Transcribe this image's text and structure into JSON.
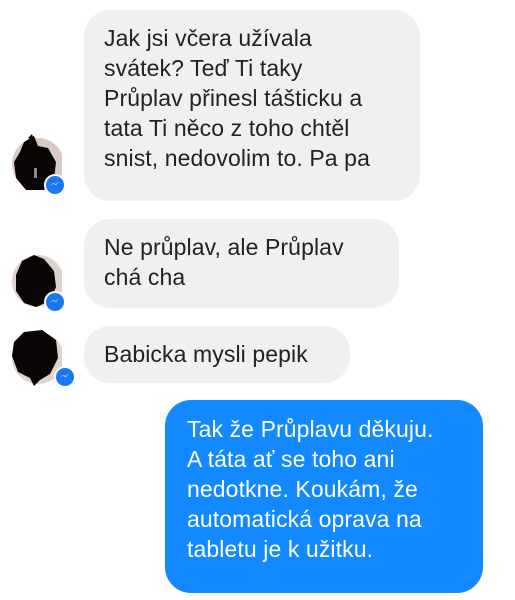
{
  "conversation": {
    "messages": [
      {
        "sender": "contact",
        "text": "Jak jsi včera užívala\nsvátek? Teď Ti taky\nPrůplav přinesl tášticku a\ntata Ti něco z toho chtěl\nsnist, nedovolim to. Pa pa"
      },
      {
        "sender": "contact",
        "text": "Ne průplav, ale  Průplav\nchá cha"
      },
      {
        "sender": "contact",
        "text": "Babicka mysli pepik"
      },
      {
        "sender": "me",
        "text": "Tak že Průplavu děkuju.\nA táta ať se toho ani\nnedotkne. Koukám, že\nautomatická oprava na\ntabletu je k užitku."
      }
    ],
    "avatar_icon": "redacted-profile-avatar",
    "badge_icon": "messenger-icon",
    "colors": {
      "incoming_bubble": "#f0f0f0",
      "outgoing_bubble": "#1289fe",
      "incoming_text": "#222222",
      "outgoing_text": "#ffffff",
      "messenger_badge": "#1a77f2"
    }
  }
}
